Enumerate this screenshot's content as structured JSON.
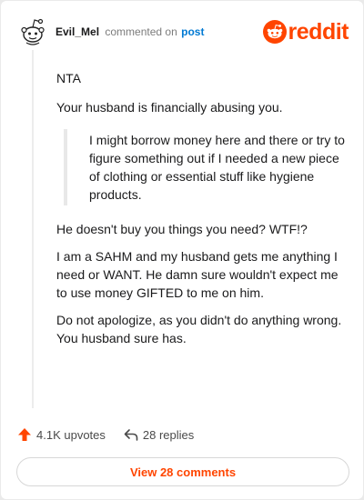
{
  "header": {
    "username": "Evil_Mel",
    "action_text": "commented on",
    "post_link": "post",
    "logo_text": "reddit"
  },
  "comment": {
    "p1": "NTA",
    "p2": "Your husband is financially abusing you.",
    "quote": "I might borrow money here and there or try to figure something out if I needed a new piece of clothing or essential stuff like hygiene products.",
    "p3": "He doesn't buy you things you need? WTF!?",
    "p4": "I am a SAHM and my husband gets me anything I need or WANT. He damn sure wouldn't expect me to use money GIFTED to me on him.",
    "p5": "Do not apologize, as you didn't do anything wrong. You husband sure has."
  },
  "footer": {
    "upvotes": "4.1K upvotes",
    "replies": "28 replies",
    "view_button": "View 28 comments"
  },
  "colors": {
    "brand": "#ff4500",
    "link": "#0079d3"
  },
  "icons": {
    "avatar": "snoo-avatar-icon",
    "logo": "reddit-logo-icon",
    "upvote": "upvote-arrow-icon",
    "reply": "reply-arrow-icon"
  }
}
